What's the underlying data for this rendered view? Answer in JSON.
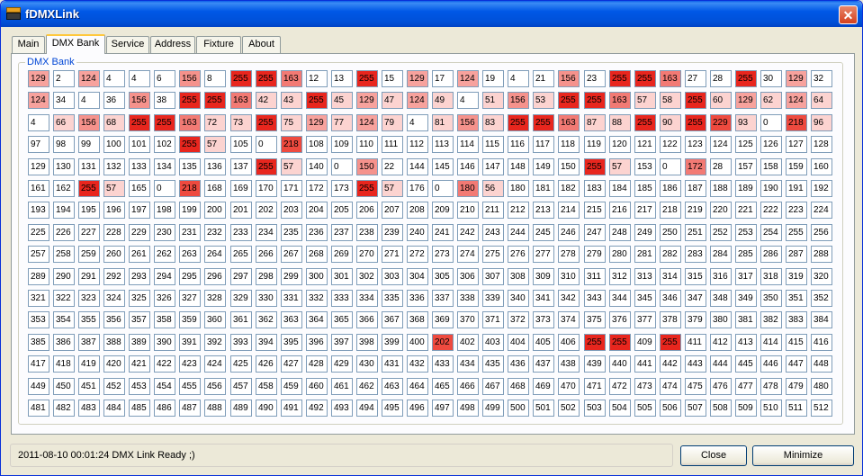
{
  "window": {
    "title": "fDMXLink",
    "close_glyph": "✕",
    "icon": "fdmxlink-app-icon",
    "close_icon": "close-icon"
  },
  "tabs": [
    {
      "label": "Main",
      "active": false
    },
    {
      "label": "DMX Bank",
      "active": true
    },
    {
      "label": "Service",
      "active": false
    },
    {
      "label": "Address",
      "active": false
    },
    {
      "label": "Fixture",
      "active": false
    },
    {
      "label": "About",
      "active": false
    }
  ],
  "bank": {
    "label": "DMX Bank",
    "columns": 32,
    "overrides": {
      "1": 129,
      "2": 2,
      "3": 124,
      "4": 4,
      "5": 4,
      "6": 6,
      "7": 156,
      "8": 8,
      "9": 255,
      "10": 255,
      "11": 163,
      "12": 12,
      "13": 13,
      "14": 255,
      "15": 15,
      "16": 129,
      "17": 17,
      "18": 124,
      "19": 19,
      "20": 4,
      "21": 21,
      "22": 156,
      "23": 23,
      "24": 255,
      "25": 255,
      "26": 163,
      "27": 27,
      "28": 28,
      "29": 255,
      "30": 30,
      "31": 129,
      "32": 32,
      "33": 124,
      "34": 34,
      "35": 4,
      "36": 36,
      "37": 156,
      "38": 38,
      "39": 255,
      "40": 255,
      "41": 163,
      "42": 42,
      "43": 43,
      "44": 255,
      "45": 45,
      "46": 129,
      "47": 47,
      "48": 124,
      "49": 49,
      "50": 4,
      "51": 51,
      "52": 156,
      "53": 53,
      "54": 255,
      "55": 255,
      "56": 163,
      "57": 57,
      "58": 58,
      "59": 255,
      "60": 60,
      "61": 129,
      "62": 62,
      "63": 124,
      "64": 64,
      "65": 4,
      "66": 66,
      "67": 156,
      "68": 68,
      "69": 255,
      "70": 255,
      "71": 163,
      "72": 72,
      "73": 73,
      "74": 255,
      "75": 75,
      "76": 129,
      "77": 77,
      "78": 124,
      "79": 79,
      "80": 4,
      "81": 81,
      "82": 156,
      "83": 83,
      "84": 255,
      "85": 255,
      "86": 163,
      "87": 87,
      "88": 88,
      "89": 255,
      "90": 90,
      "91": 255,
      "92": 229,
      "93": 93,
      "94": 0,
      "95": 218,
      "96": 96,
      "103": 255,
      "104": 57,
      "106": 0,
      "107": 218,
      "138": 255,
      "139": 57,
      "141": 0,
      "142": 150,
      "143": 22,
      "151": 255,
      "152": 57,
      "154": 0,
      "155": 172,
      "156": 28,
      "163": 255,
      "164": 57,
      "166": 0,
      "167": 218,
      "174": 255,
      "175": 57,
      "177": 0,
      "178": 180,
      "179": 56,
      "401": 202,
      "407": 255,
      "408": 255,
      "410": 255
    }
  },
  "status": {
    "text": "2011-08-10 00:01:24 DMX Link Ready ;)"
  },
  "buttons": {
    "close": "Close",
    "minimize": "Minimize"
  },
  "colors": {
    "window_border": "#0831d9",
    "titlebar": "#0058e6",
    "cell_border": "#7f9db9",
    "value_heat_max": "#e8261e",
    "value_heat_min": "#ffffff"
  }
}
